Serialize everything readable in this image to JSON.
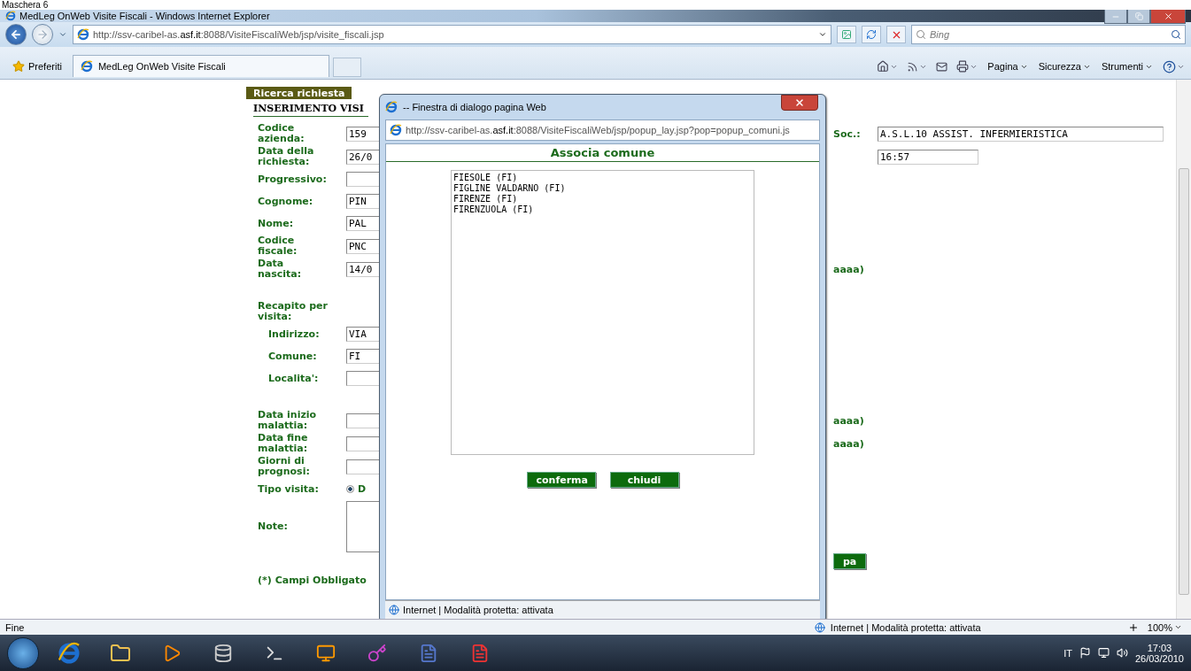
{
  "caption": "Maschera 6",
  "window": {
    "title": "MedLeg OnWeb Visite Fiscali - Windows Internet Explorer"
  },
  "address_bar": {
    "url": "http://ssv-caribel-as.**asf.it**:8088/VisiteFiscaliWeb/jsp/visite_fiscali.jsp"
  },
  "search": {
    "placeholder": "Bing"
  },
  "favorites": {
    "label": "Preferiti"
  },
  "tabs": [
    {
      "label": "MedLeg OnWeb Visite Fiscali",
      "selected": true
    }
  ],
  "commands": [
    "Pagina",
    "Sicurezza",
    "Strumenti"
  ],
  "page": {
    "nav_button": "Ricerca richiesta",
    "heading": "INSERIMENTO VISI",
    "groups": [
      [
        {
          "kind": "field",
          "label": "Codice\nazienda:",
          "value": "159",
          "side": {
            "kind": "labeled_field",
            "label": "Soc.:",
            "value": "A.S.L.10 ASSIST. INFERMIERISTICA"
          }
        },
        {
          "kind": "field",
          "label": "Data della\nrichiesta:",
          "value": "26/0",
          "side": {
            "kind": "field",
            "value": "16:57"
          }
        },
        {
          "kind": "field",
          "label": "Progressivo:"
        },
        {
          "kind": "field",
          "label": "Cognome:",
          "value": "PIN"
        },
        {
          "kind": "field",
          "label": "Nome:",
          "value": "PAL"
        },
        {
          "kind": "field",
          "label": "Codice\nfiscale:",
          "value": "PNC"
        },
        {
          "kind": "field",
          "label": "Data\nnascita:",
          "value": "14/0",
          "side": {
            "kind": "text",
            "text": "aaaa)"
          }
        }
      ],
      [
        {
          "kind": "section",
          "label": "Recapito per\nvisita:"
        },
        {
          "kind": "subfield",
          "label": "Indirizzo:",
          "value": "VIA"
        },
        {
          "kind": "subfield",
          "label": "Comune:",
          "value": "FI"
        },
        {
          "kind": "subfield",
          "label": "Localita':"
        }
      ],
      [
        {
          "kind": "field",
          "label": "Data inizio\nmalattia:",
          "side": {
            "kind": "text",
            "text": "aaaa)"
          }
        },
        {
          "kind": "field",
          "label": "Data fine\nmalattia:",
          "side": {
            "kind": "text",
            "text": "aaaa)"
          }
        },
        {
          "kind": "field",
          "label": "Giorni di\nprognosi:"
        },
        {
          "kind": "radio",
          "label": "Tipo visita:",
          "options": [
            {
              "label": "D",
              "selected": true
            }
          ]
        },
        {
          "kind": "textarea",
          "label": "Note:"
        }
      ]
    ],
    "side_button": "pa",
    "footnote": "(*) Campi Obbligato"
  },
  "dialog": {
    "title": "-- Finestra di dialogo pagina Web",
    "url": "http://ssv-caribel-as.**asf.it**:8088/VisiteFiscaliWeb/jsp/popup_lay.jsp?pop=popup_comuni.js",
    "heading": "Associa comune",
    "options": [
      {
        "label": "FIESOLE (FI)",
        "selected": false
      },
      {
        "label": "FIGLINE VALDARNO (FI)",
        "selected": false
      },
      {
        "label": "FIRENZE (FI)",
        "selected": false
      },
      {
        "label": "FIRENZUOLA (FI)",
        "selected": false
      }
    ],
    "buttons": [
      "conferma",
      "chiudi"
    ],
    "status": "Internet | Modalità protetta: attivata"
  },
  "status_bar": {
    "text": "Fine",
    "zone": "Internet | Modalità protetta: attivata",
    "zoom": "100%"
  },
  "taskbar": {
    "language": "IT",
    "time": "17:03",
    "date": "26/03/2010"
  }
}
